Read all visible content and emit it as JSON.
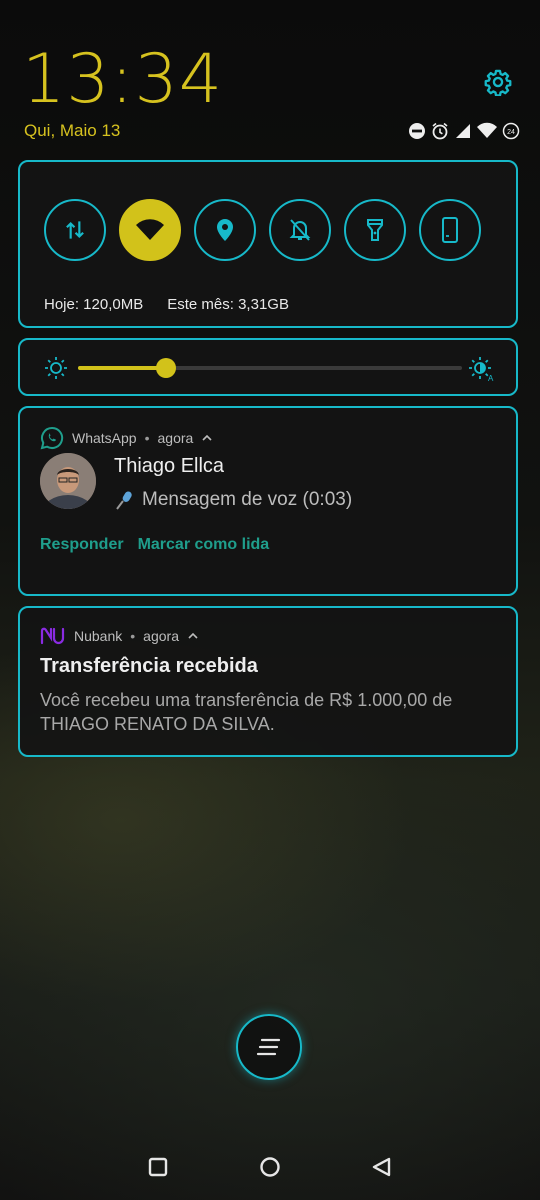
{
  "status": {
    "time": "13:34",
    "date": "Qui, Maio 13",
    "battery_label": "24"
  },
  "quick_settings": {
    "tiles": [
      {
        "icon": "mobile-data-icon",
        "active": false
      },
      {
        "icon": "wifi-icon",
        "active": true
      },
      {
        "icon": "location-icon",
        "active": false
      },
      {
        "icon": "do-not-disturb-icon",
        "active": false
      },
      {
        "icon": "flashlight-icon",
        "active": false
      },
      {
        "icon": "auto-rotate-icon",
        "active": false
      }
    ],
    "data_today": "Hoje: 120,0MB",
    "data_month": "Este mês: 3,31GB",
    "brightness": 0.23
  },
  "notifications": [
    {
      "app": "WhatsApp",
      "time": "agora",
      "sender": "Thiago Ellca",
      "message": "Mensagem de voz (0:03)",
      "actions": [
        "Responder",
        "Marcar como lida"
      ]
    },
    {
      "app": "Nubank",
      "time": "agora",
      "title": "Transferência recebida",
      "body": "Você recebeu uma transferência de R$ 1.000,00 de THIAGO RENATO DA SILVA."
    }
  ],
  "colors": {
    "accent": "#17b9c9",
    "yellow": "#d2c21a",
    "action_green": "#1f9e8c",
    "nubank_purple": "#8a2be2",
    "whatsapp_green": "#1f9e8c"
  }
}
